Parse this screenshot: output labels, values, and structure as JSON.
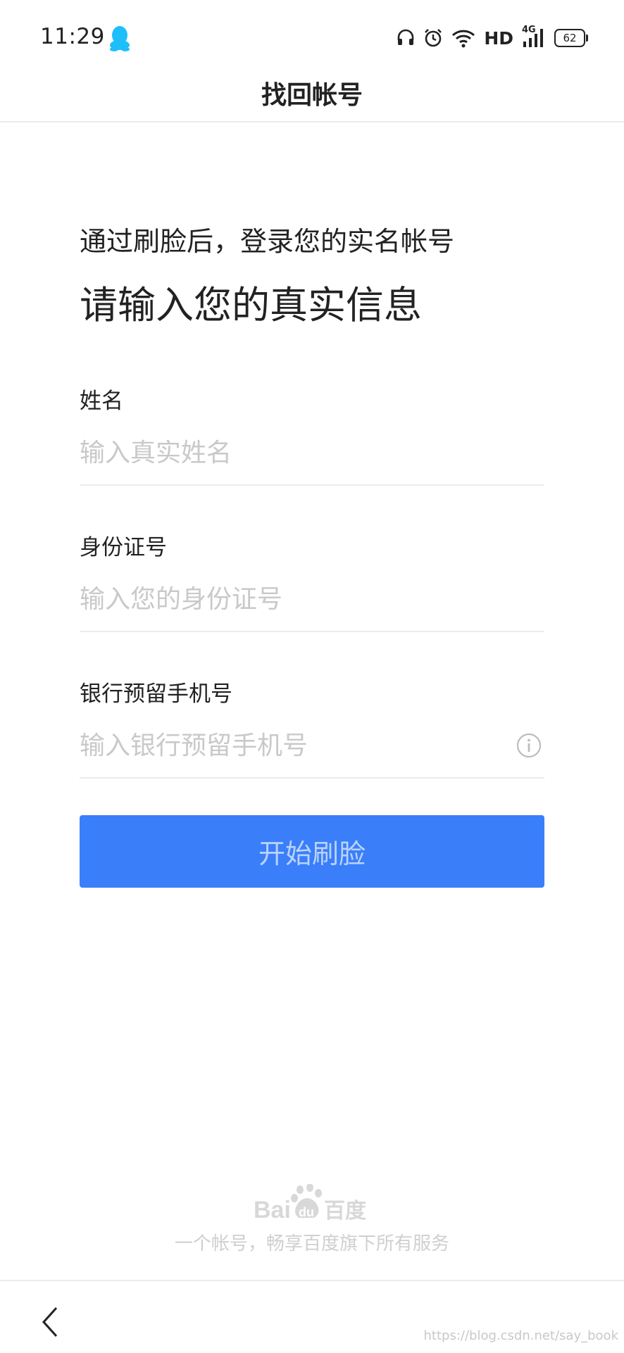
{
  "status_bar": {
    "time": "11:29",
    "network_label": "HD",
    "signal_label": "4G",
    "battery": "62",
    "icons": [
      "qq-icon",
      "headset-icon",
      "alarm-icon",
      "wifi-icon",
      "signal-icon",
      "battery-icon"
    ]
  },
  "header": {
    "title": "找回帐号"
  },
  "intro": {
    "subtitle": "通过刷脸后，登录您的实名帐号",
    "title": "请输入您的真实信息"
  },
  "form": {
    "name": {
      "label": "姓名",
      "value": "",
      "placeholder": "输入真实姓名"
    },
    "id_number": {
      "label": "身份证号",
      "value": "",
      "placeholder": "输入您的身份证号"
    },
    "phone": {
      "label": "银行预留手机号",
      "value": "",
      "placeholder": "输入银行预留手机号"
    }
  },
  "actions": {
    "start_label": "开始刷脸"
  },
  "footer": {
    "brand": "Bai du 百度",
    "slogan": "一个帐号，畅享百度旗下所有服务"
  },
  "watermark": "https://blog.csdn.net/say_book",
  "colors": {
    "accent": "#3a7ff9",
    "placeholder": "#c9c9c9",
    "qq_icon": "#1ebefa"
  }
}
